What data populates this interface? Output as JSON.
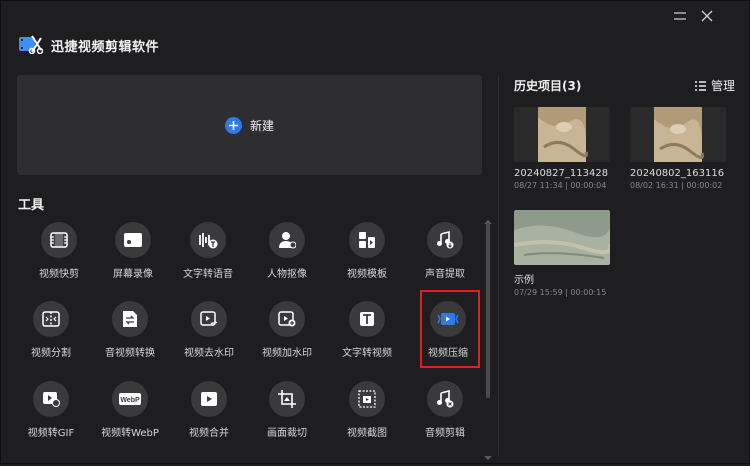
{
  "app": {
    "title": "迅捷视频剪辑软件"
  },
  "window_controls": {
    "minimize": "minimize-icon",
    "close": "close-icon"
  },
  "new_project": {
    "label": "新建"
  },
  "tools": {
    "title": "工具",
    "items": [
      {
        "label": "视频快剪",
        "icon": "film-icon"
      },
      {
        "label": "屏幕录像",
        "icon": "screen-record-icon"
      },
      {
        "label": "文字转语音",
        "icon": "text-to-speech-icon"
      },
      {
        "label": "人物抠像",
        "icon": "person-cutout-icon"
      },
      {
        "label": "视频模板",
        "icon": "template-icon"
      },
      {
        "label": "声音提取",
        "icon": "audio-extract-icon"
      },
      {
        "label": "视频分割",
        "icon": "split-icon"
      },
      {
        "label": "音视频转换",
        "icon": "convert-icon"
      },
      {
        "label": "视频去水印",
        "icon": "remove-watermark-icon"
      },
      {
        "label": "视频加水印",
        "icon": "add-watermark-icon"
      },
      {
        "label": "文字转视频",
        "icon": "text-to-video-icon"
      },
      {
        "label": "视频压缩",
        "icon": "compress-icon"
      },
      {
        "label": "视频转GIF",
        "icon": "gif-icon"
      },
      {
        "label": "视频转WebP",
        "icon": "webp-icon"
      },
      {
        "label": "视频合并",
        "icon": "merge-icon"
      },
      {
        "label": "画面裁切",
        "icon": "crop-icon"
      },
      {
        "label": "视频截图",
        "icon": "screenshot-icon"
      },
      {
        "label": "音频剪辑",
        "icon": "audio-edit-icon"
      }
    ]
  },
  "history": {
    "title": "历史项目(3)",
    "manage_label": "管理",
    "items": [
      {
        "name": "20240827_113428",
        "meta": "08/27 11:34 | 00:00:04"
      },
      {
        "name": "20240802_163116",
        "meta": "08/02 16:31 | 00:00:02"
      },
      {
        "name": "示例",
        "meta": "07/29 15:59 | 00:00:15"
      }
    ]
  },
  "colors": {
    "accent": "#2d7be8",
    "highlight": "#e02020",
    "background": "#1e1e20",
    "card": "#2e2e31"
  }
}
